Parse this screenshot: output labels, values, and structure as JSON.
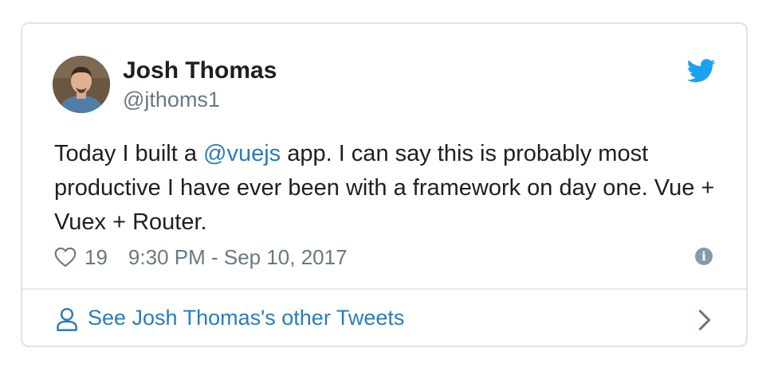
{
  "tweet": {
    "author_name": "Josh Thomas",
    "author_handle": "@jthoms1",
    "text_before": "Today I built a ",
    "mention": "@vuejs",
    "text_after": " app.  I can say this is probably most productive I have ever been with a framework on day one. Vue + Vuex + Router.",
    "likes": "19",
    "timestamp": "9:30 PM - Sep 10, 2017",
    "info_glyph": "i"
  },
  "footer": {
    "link_label": "See Josh Thomas's other Tweets"
  },
  "icons": {
    "brand": "twitter-bird-icon",
    "like": "heart-icon",
    "info": "info-icon",
    "person": "person-icon",
    "chevron": "chevron-right-icon"
  },
  "colors": {
    "text": "#1c2022",
    "muted": "#697882",
    "link": "#2b7bb9",
    "brand": "#1da1f2",
    "border": "#dfe3e6"
  }
}
